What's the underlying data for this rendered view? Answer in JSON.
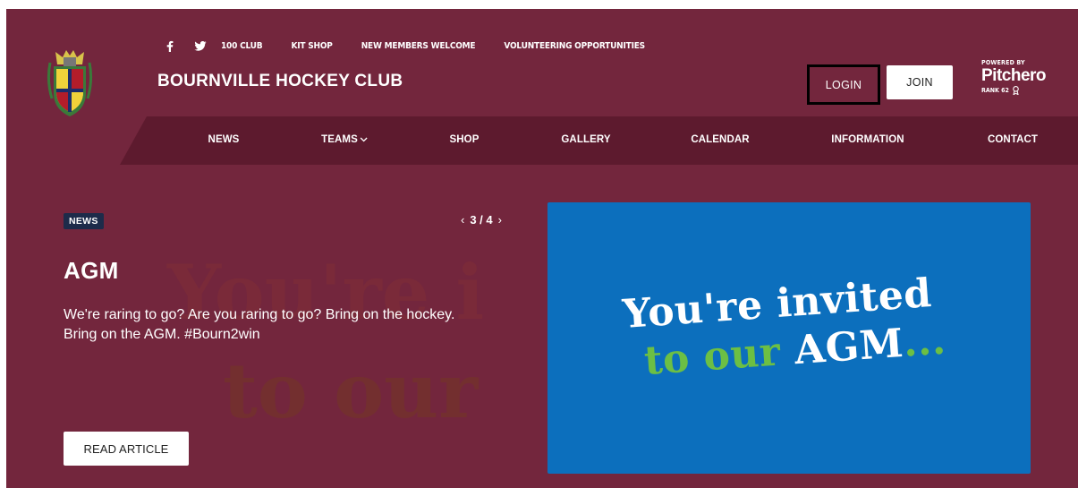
{
  "header": {
    "club_name": "BOURNVILLE HOCKEY CLUB",
    "top_links": [
      "100 CLUB",
      "KIT SHOP",
      "NEW MEMBERS WELCOME",
      "VOLUNTEERING OPPORTUNITIES"
    ],
    "social_icons": [
      "facebook-icon",
      "twitter-icon"
    ],
    "login_label": "LOGIN",
    "join_label": "JOIN",
    "powered_by": "POWERED BY",
    "brand": "Pitchero",
    "rank": "RANK 62"
  },
  "nav": {
    "items": [
      "NEWS",
      "TEAMS",
      "SHOP",
      "GALLERY",
      "CALENDAR",
      "INFORMATION",
      "CONTACT"
    ]
  },
  "hero": {
    "badge": "NEWS",
    "slide_counter": "3 / 4",
    "title": "AGM",
    "description": "We're raring to go? Are you raring to go? Bring on the hockey. Bring on the AGM. #Bourn2win",
    "read_label": "READ ARTICLE",
    "bg_line1": "You're i",
    "bg_line2": "to our",
    "image_line1": "You're invited",
    "image_line2a": "to our",
    "image_line2b": "AGM",
    "image_line2c": "..."
  },
  "colors": {
    "background": "#73263d",
    "nav_band": "#5d1a2e",
    "badge": "#1d2b4a",
    "image_blue": "#0c6fbd",
    "image_green": "#6cbf44"
  }
}
